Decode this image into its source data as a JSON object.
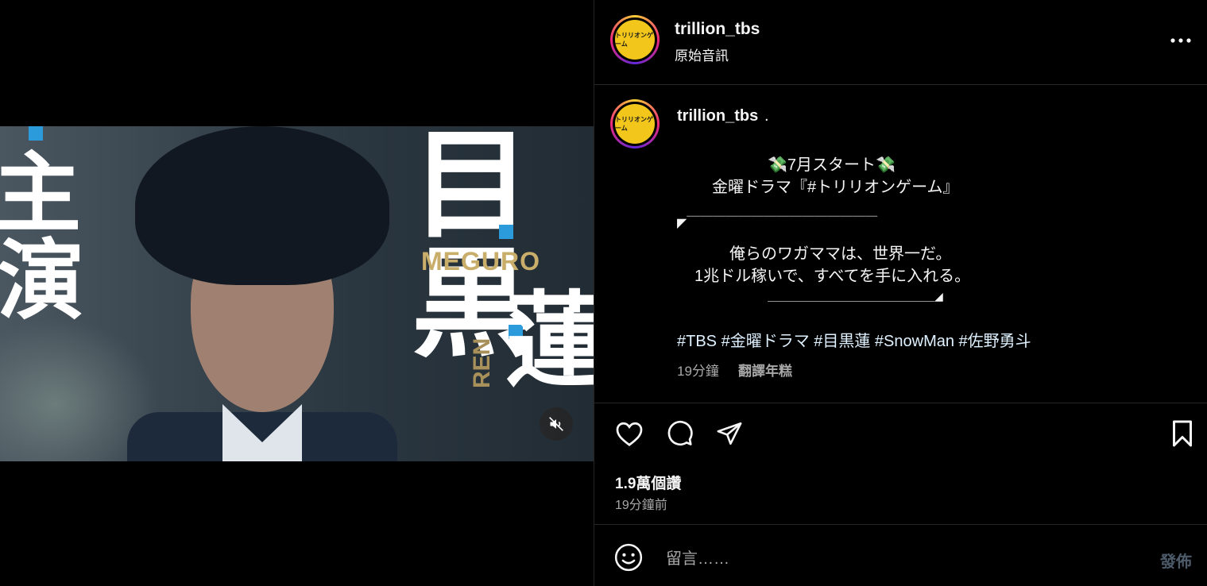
{
  "video": {
    "overlay_texts": [
      "主",
      "演",
      "目黒",
      "蓮"
    ],
    "name_romaji": "MEGURO",
    "name_romaji_first": "REN",
    "mute_icon": "speaker-muted-icon"
  },
  "header": {
    "username": "trillion_tbs",
    "audio_label": "原始音訊",
    "avatar_text": "トリリオンゲーム",
    "more_icon": "more-horizontal-icon"
  },
  "caption": {
    "username": "trillion_tbs",
    "dot": ".",
    "avatar_text": "トリリオンゲーム",
    "lines": [
      "💸7月スタート💸",
      "金曜ドラマ『#トリリオンゲーム』",
      "◤￣￣￣￣￣￣￣￣￣￣￣￣￣￣￣",
      "俺らのワガママは、世界一だ。",
      "1兆ドル稼いで、すべてを手に入れる。",
      "＿＿＿＿＿＿＿＿＿＿＿＿＿＿＿◢"
    ],
    "hashtags": "#TBS #金曜ドラマ #目黒蓮 #SnowMan #佐野勇斗",
    "time": "19分鐘",
    "translate": "翻譯年糕"
  },
  "actions": {
    "icons": [
      "heart-icon",
      "comment-icon",
      "share-icon",
      "bookmark-icon"
    ],
    "likes": "1.9萬個讚",
    "posted_ago": "19分鐘前"
  },
  "comment": {
    "placeholder": "留言……",
    "post_label": "發佈",
    "emoji_icon": "emoji-icon"
  }
}
